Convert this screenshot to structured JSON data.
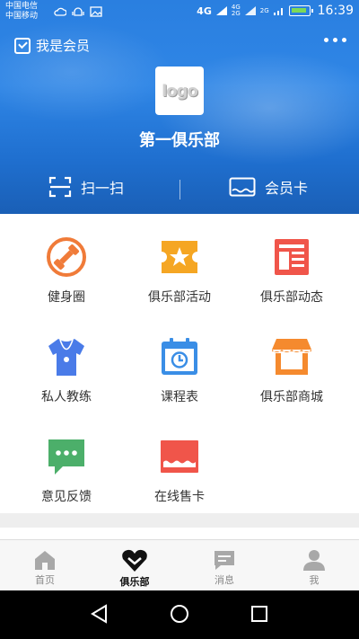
{
  "status_bar": {
    "carrier_1": "中国电信",
    "carrier_2": "中国移动",
    "network_1": "4G",
    "network_2": "4G",
    "network_3": "2G",
    "network_4": "2G",
    "time": "16:39"
  },
  "header": {
    "member_label": "我是会员",
    "logo_text": "logo",
    "club_name": "第一俱乐部",
    "scan_label": "扫一扫",
    "card_label": "会员卡"
  },
  "grid_items": [
    {
      "label": "健身圈",
      "icon": "dumbbell-circle-icon",
      "color": "#f07b39"
    },
    {
      "label": "俱乐部活动",
      "icon": "ticket-star-icon",
      "color": "#f5a623"
    },
    {
      "label": "俱乐部动态",
      "icon": "news-icon",
      "color": "#f0554a"
    },
    {
      "label": "私人教练",
      "icon": "coach-shirt-icon",
      "color": "#4a7be8"
    },
    {
      "label": "课程表",
      "icon": "calendar-clock-icon",
      "color": "#3a8ee6"
    },
    {
      "label": "俱乐部商城",
      "icon": "store-icon",
      "color": "#f58a2e"
    },
    {
      "label": "意见反馈",
      "icon": "chat-bubble-icon",
      "color": "#4caf6a"
    },
    {
      "label": "在线售卡",
      "icon": "card-sale-icon",
      "color": "#f0554a"
    }
  ],
  "tabs": [
    {
      "label": "首页",
      "icon": "home-icon"
    },
    {
      "label": "俱乐部",
      "icon": "club-heart-icon"
    },
    {
      "label": "消息",
      "icon": "message-icon"
    },
    {
      "label": "我",
      "icon": "person-icon"
    }
  ],
  "active_tab": "俱乐部"
}
